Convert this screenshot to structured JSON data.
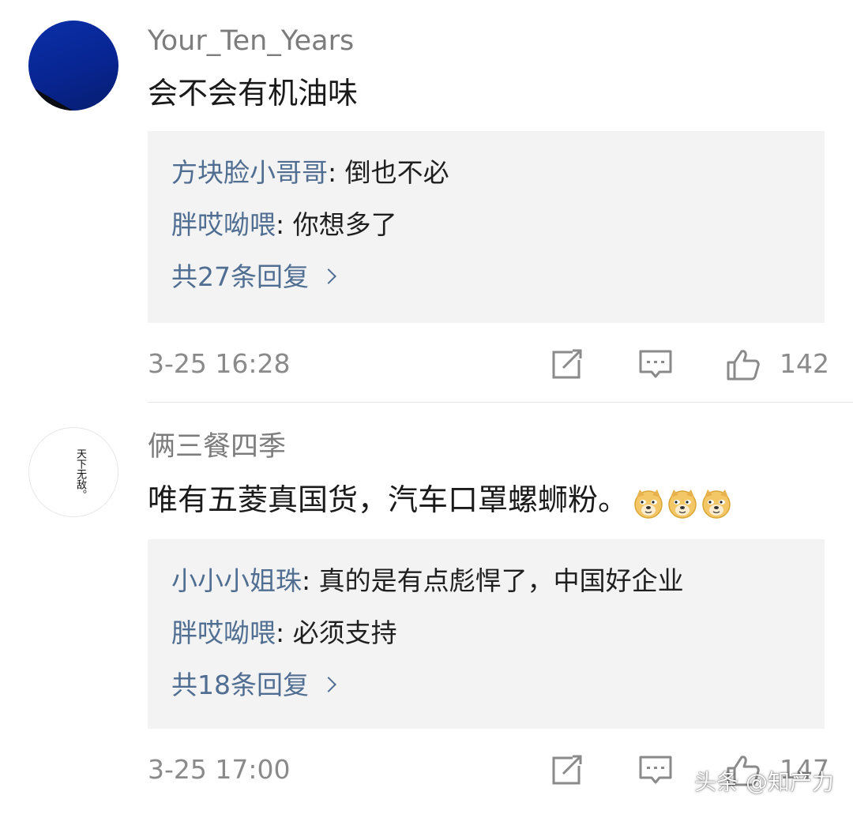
{
  "comments": [
    {
      "username": "Your_Ten_Years",
      "text": "会不会有机油味",
      "replies": [
        {
          "author": "方块脸小哥哥",
          "sep": ": ",
          "text": "倒也不必"
        },
        {
          "author": "胖哎呦喂",
          "sep": ": ",
          "text": "你想多了"
        }
      ],
      "more_replies": "共27条回复",
      "timestamp": "3-25 16:28",
      "like_count": "142"
    },
    {
      "username": "俩三餐四季",
      "avatar_text": "天下无敌。",
      "text": "唯有五菱真国货，汽车口罩螺蛳粉。",
      "emoji": [
        "doge-emoji",
        "doge-emoji",
        "doge-emoji"
      ],
      "replies": [
        {
          "author": "小小小姐珠",
          "sep": ": ",
          "text": "真的是有点彪悍了，中国好企业"
        },
        {
          "author": "胖哎呦喂",
          "sep": ": ",
          "text": "必须支持"
        }
      ],
      "more_replies": "共18条回复",
      "timestamp": "3-25 17:00",
      "like_count": "147"
    }
  ],
  "watermark": "头条 @知产力",
  "colors": {
    "link": "#4f6e92",
    "reply_bg": "#f3f3f3",
    "meta": "#8a8a8a"
  }
}
